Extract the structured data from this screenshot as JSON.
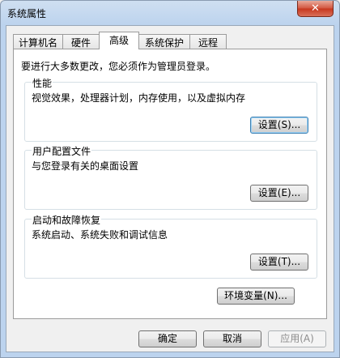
{
  "window": {
    "title": "系统属性"
  },
  "tabs": [
    {
      "label": "计算机名"
    },
    {
      "label": "硬件"
    },
    {
      "label": "高级"
    },
    {
      "label": "系统保护"
    },
    {
      "label": "远程"
    }
  ],
  "advanced": {
    "notice": "要进行大多数更改，您必须作为管理员登录。",
    "performance": {
      "title": "性能",
      "desc": "视觉效果，处理器计划，内存使用，以及虚拟内存",
      "button": "设置(S)..."
    },
    "user_profiles": {
      "title": "用户配置文件",
      "desc": "与您登录有关的桌面设置",
      "button": "设置(E)..."
    },
    "startup_recovery": {
      "title": "启动和故障恢复",
      "desc": "系统启动、系统失败和调试信息",
      "button": "设置(T)..."
    },
    "env_button": "环境变量(N)..."
  },
  "footer": {
    "ok": "确定",
    "cancel": "取消",
    "apply": "应用(A)"
  },
  "icons": {
    "close": "close-icon"
  }
}
